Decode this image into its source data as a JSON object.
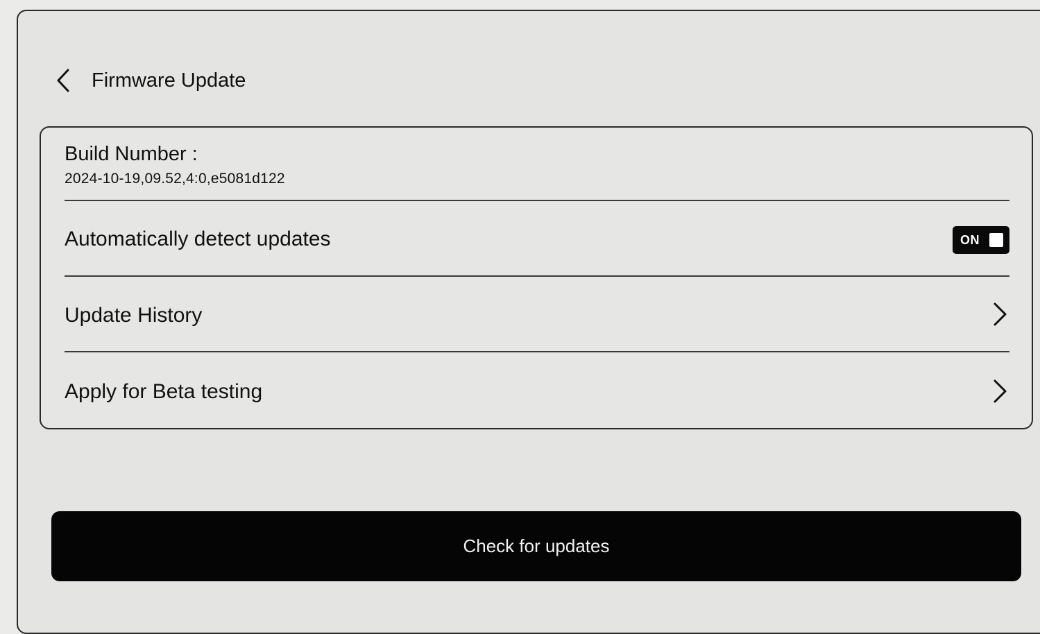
{
  "header": {
    "title": "Firmware Update",
    "back_icon": "chevron-left-icon"
  },
  "build": {
    "label": "Build Number :",
    "value": "2024-10-19,09.52,4:0,e5081d122"
  },
  "settings": {
    "auto_detect": {
      "label": "Automatically detect updates",
      "toggle_text": "ON",
      "enabled": true
    },
    "update_history": {
      "label": "Update History",
      "icon": "chevron-right-icon"
    },
    "beta": {
      "label": "Apply for Beta testing",
      "icon": "chevron-right-icon"
    }
  },
  "actions": {
    "check_label": "Check for updates"
  },
  "colors": {
    "background": "#e4e4e3",
    "button": "#050505",
    "text": "#111111"
  }
}
